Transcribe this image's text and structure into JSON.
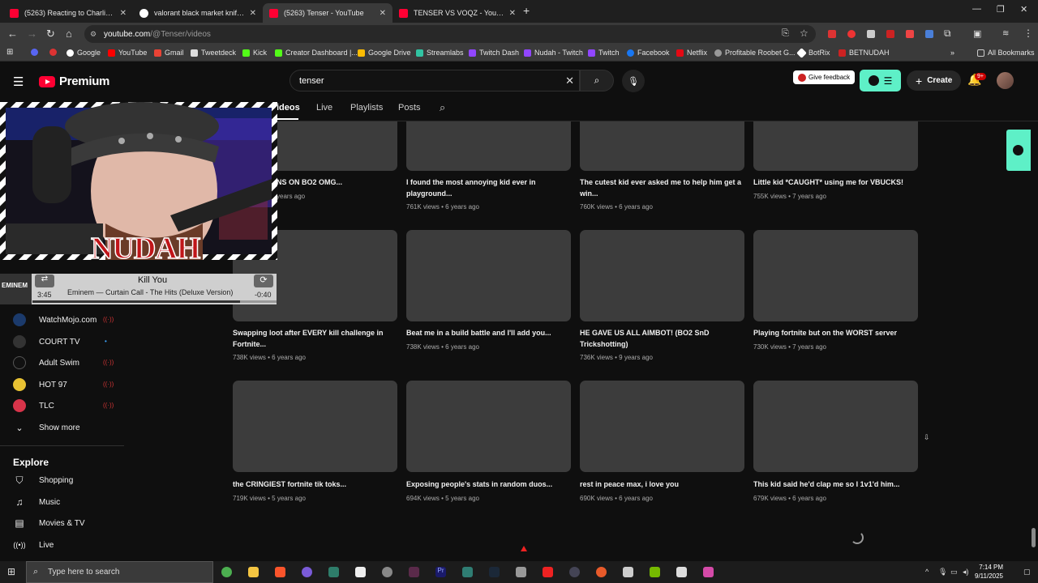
{
  "browser": {
    "tabs": [
      {
        "title": "(5263) Reacting to Charlie Kirk",
        "icon": "youtube-icon",
        "active": false
      },
      {
        "title": "valorant black market knife eas",
        "icon": "google-icon",
        "active": false
      },
      {
        "title": "(5263) Tenser - YouTube",
        "icon": "youtube-icon",
        "active": true
      },
      {
        "title": "TENSER VS VOQZ - YouTube",
        "icon": "youtube-icon",
        "active": false
      }
    ],
    "close_glyph": "✕",
    "new_tab": "+",
    "url_host": "youtube.com",
    "url_path": "/@Tenser/videos",
    "bookmarks": [
      "Google",
      "YouTube",
      "Gmail",
      "Tweetdeck",
      "Kick",
      "Creator Dashboard |...",
      "Google Drive",
      "Streamlabs",
      "Twitch Dash",
      "Nudah - Twitch",
      "Twitch",
      "Facebook",
      "Netflix",
      "Profitable Roobet G...",
      "BotRix",
      "BETNUDAH"
    ],
    "all_bookmarks": "All Bookmarks"
  },
  "youtube": {
    "logo_text": "Premium",
    "search_value": "tenser",
    "feedback_label": "Give feedback",
    "create_label": "Create",
    "notification_count": "9+",
    "channel_tabs": [
      "ideos",
      "Live",
      "Playlists",
      "Posts"
    ],
    "videos": [
      {
        "title": "NS ON BO2 OMG...",
        "meta": "years ago"
      },
      {
        "title": "I found the most annoying kid ever in playground...",
        "meta": "761K views • 6 years ago"
      },
      {
        "title": "The cutest kid ever asked me to help him get a win...",
        "meta": "760K views • 6 years ago"
      },
      {
        "title": "Little kid *CAUGHT* using me for VBUCKS!",
        "meta": "755K views • 7 years ago"
      },
      {
        "title": "Swapping loot after EVERY kill challenge in Fortnite...",
        "meta": "738K views • 6 years ago"
      },
      {
        "title": "Beat me in a build battle and I'll add you...",
        "meta": "738K views • 6 years ago"
      },
      {
        "title": "HE GAVE US ALL AIMBOT! (BO2 SnD Trickshotting)",
        "meta": "736K views • 9 years ago"
      },
      {
        "title": "Playing fortnite but on the WORST server",
        "meta": "730K views • 7 years ago"
      },
      {
        "title": "the CRINGIEST fortnite tik toks...",
        "meta": "719K views • 5 years ago"
      },
      {
        "title": "Exposing people's stats in random duos...",
        "meta": "694K views • 5 years ago"
      },
      {
        "title": "rest in peace max, i love you",
        "meta": "690K views • 6 years ago"
      },
      {
        "title": "This kid said he'd clap me so I 1v1'd him...",
        "meta": "679K views • 6 years ago"
      }
    ],
    "subscriptions": [
      {
        "name": "WatchMojo.com",
        "color": "#1b3a6b"
      },
      {
        "name": "COURT TV",
        "color": "#333333"
      },
      {
        "name": "Adult Swim",
        "color": "#111111"
      },
      {
        "name": "HOT 97",
        "color": "#e8c233"
      },
      {
        "name": "TLC",
        "color": "#d8344a"
      }
    ],
    "show_more": "Show more",
    "explore_title": "Explore",
    "explore_items": [
      "Shopping",
      "Music",
      "Movies & TV",
      "Live"
    ]
  },
  "overlay": {
    "streamer_name": "NUDAH",
    "album_label": "EMINEM",
    "song_title": "Kill You",
    "song_artist": "Eminem — Curtain Call - The Hits (Deluxe Version)",
    "time_elapsed": "3:45",
    "time_remaining": "-0:40",
    "progress_fraction": 0.85
  },
  "taskbar": {
    "search_placeholder": "Type here to search",
    "time": "7:14 PM",
    "date": "9/11/2025"
  },
  "colors": {
    "accent": "#ff0033",
    "brand_green": "#5ef0c7",
    "background": "#0f0f0f"
  }
}
